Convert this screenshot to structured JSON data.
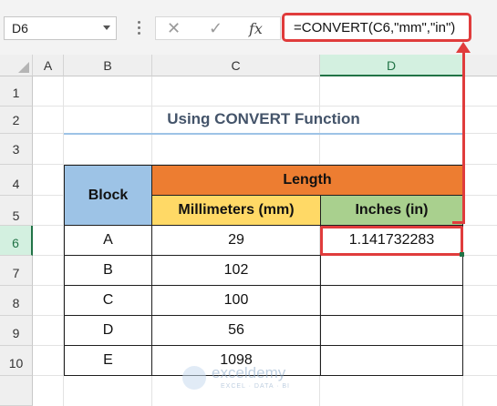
{
  "formula_bar": {
    "name_box": "D6",
    "cancel_icon": "✕",
    "enter_icon": "✓",
    "fx_label": "fx",
    "formula": "=CONVERT(C6,\"mm\",\"in\")"
  },
  "columns": [
    "A",
    "B",
    "C",
    "D"
  ],
  "rows": [
    "1",
    "2",
    "3",
    "4",
    "5",
    "6",
    "7",
    "8",
    "9",
    "10"
  ],
  "selected": {
    "column": "D",
    "row": "6"
  },
  "sheet": {
    "title": "Using CONVERT Function",
    "table": {
      "header_block": "Block",
      "header_length": "Length",
      "header_mm": "Millimeters (mm)",
      "header_in": "Inches (in)",
      "rows": [
        {
          "block": "A",
          "mm": "29",
          "in": "1.141732283"
        },
        {
          "block": "B",
          "mm": "102",
          "in": ""
        },
        {
          "block": "C",
          "mm": "100",
          "in": ""
        },
        {
          "block": "D",
          "mm": "56",
          "in": ""
        },
        {
          "block": "E",
          "mm": "1098",
          "in": ""
        }
      ]
    }
  },
  "watermark": {
    "name": "exceldemy",
    "tagline": "EXCEL · DATA · BI"
  },
  "colors": {
    "block_header": "#9dc3e6",
    "length_header": "#ed7d31",
    "mm_header": "#ffd966",
    "in_header": "#a9d08e",
    "highlight": "#e03c3c",
    "selection": "#217346"
  },
  "icons": [
    "dropdown-arrow-icon",
    "more-options-icon",
    "cancel-icon",
    "enter-icon",
    "insert-function-icon"
  ]
}
